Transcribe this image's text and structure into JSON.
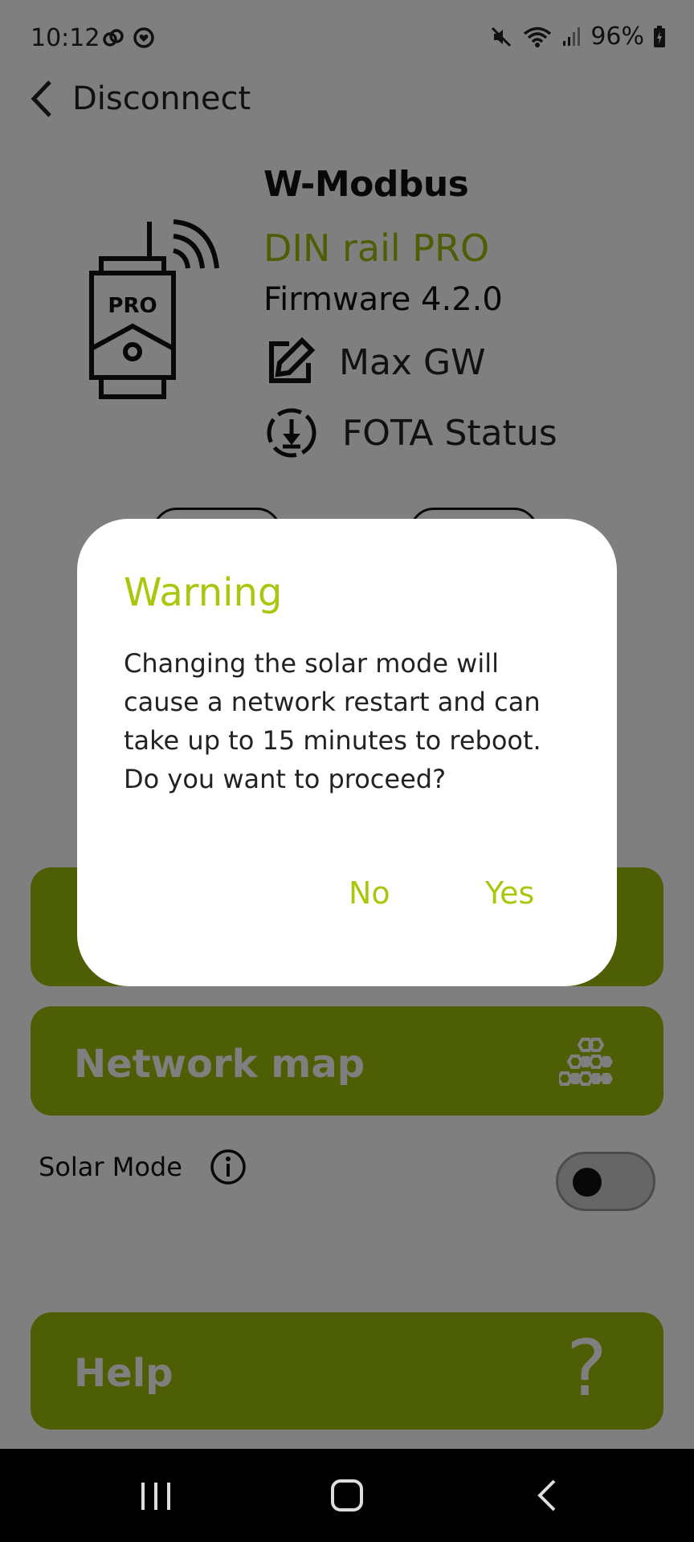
{
  "status_bar": {
    "time": "10:12",
    "battery": "96%"
  },
  "header": {
    "back_label": "Disconnect"
  },
  "device": {
    "name": "W-Modbus",
    "model": "DIN rail PRO",
    "firmware": "Firmware 4.2.0",
    "gateway_name": "Max GW",
    "fota_label": "FOTA Status",
    "illustration_text": "PRO"
  },
  "buttons": {
    "network_map": "Network map",
    "help": "Help",
    "help_icon_glyph": "?"
  },
  "solar": {
    "label": "Solar Mode",
    "enabled": false
  },
  "dialog": {
    "title": "Warning",
    "message": "Changing the solar mode will cause a network restart and can take up to 15 minutes to reboot. Do you want to proceed?",
    "no_label": "No",
    "yes_label": "Yes"
  },
  "colors": {
    "accent": "#9bbd0a",
    "dialog_accent": "#a8c80e"
  }
}
